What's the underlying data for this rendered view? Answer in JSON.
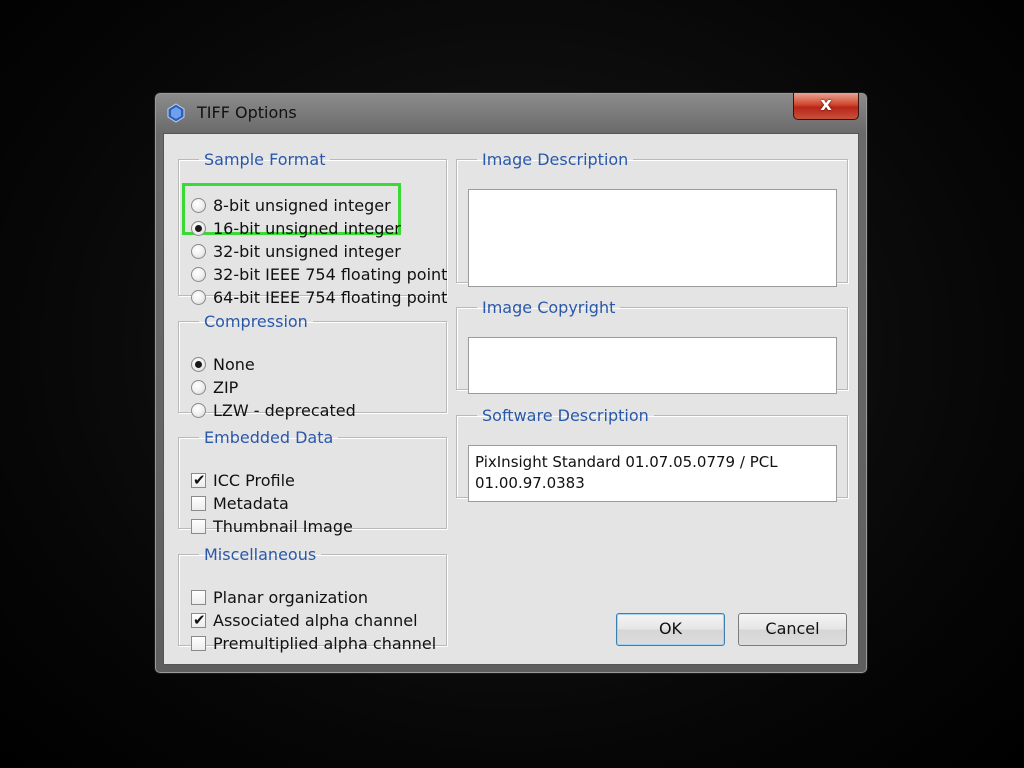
{
  "window": {
    "title": "TIFF Options",
    "close_label": "x"
  },
  "sample_format": {
    "legend": "Sample Format",
    "options": [
      {
        "label": "8-bit unsigned integer",
        "selected": false
      },
      {
        "label": "16-bit unsigned integer",
        "selected": true
      },
      {
        "label": "32-bit unsigned integer",
        "selected": false
      },
      {
        "label": "32-bit IEEE 754 floating point",
        "selected": false
      },
      {
        "label": "64-bit IEEE 754 floating point",
        "selected": false
      }
    ]
  },
  "compression": {
    "legend": "Compression",
    "options": [
      {
        "label": "None",
        "selected": true
      },
      {
        "label": "ZIP",
        "selected": false
      },
      {
        "label": "LZW - deprecated",
        "selected": false
      }
    ]
  },
  "embedded_data": {
    "legend": "Embedded Data",
    "options": [
      {
        "label": "ICC Profile",
        "checked": true
      },
      {
        "label": "Metadata",
        "checked": false
      },
      {
        "label": "Thumbnail Image",
        "checked": false
      }
    ]
  },
  "miscellaneous": {
    "legend": "Miscellaneous",
    "options": [
      {
        "label": "Planar organization",
        "checked": false
      },
      {
        "label": "Associated alpha channel",
        "checked": true
      },
      {
        "label": "Premultiplied alpha channel",
        "checked": false
      }
    ]
  },
  "image_description": {
    "legend": "Image Description",
    "value": ""
  },
  "image_copyright": {
    "legend": "Image Copyright",
    "value": ""
  },
  "software_description": {
    "legend": "Software Description",
    "value": "PixInsight Standard 01.07.05.0779 / PCL 01.00.97.0383"
  },
  "buttons": {
    "ok": "OK",
    "cancel": "Cancel"
  },
  "colors": {
    "legend_text": "#2a58a8",
    "highlight": "#3ad934",
    "client_bg": "#e4e4e4"
  }
}
